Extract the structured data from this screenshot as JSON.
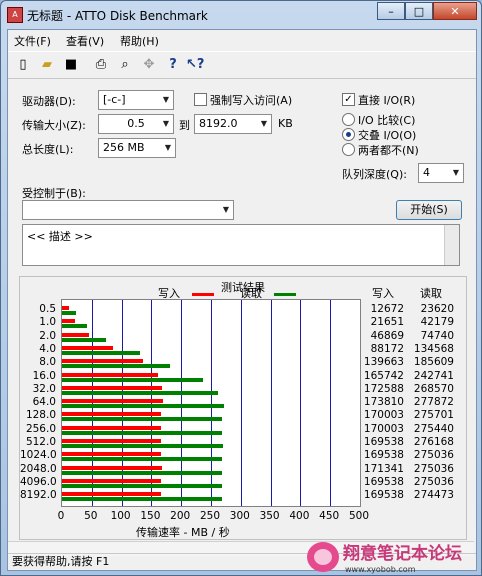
{
  "window": {
    "title": "无标题 - ATTO Disk Benchmark",
    "controls": {
      "minimize": "–",
      "maximize": "□",
      "close": "✕"
    }
  },
  "menu": [
    "文件(F)",
    "查看(V)",
    "帮助(H)"
  ],
  "toolbar": [
    "new-icon",
    "open-icon",
    "save-icon",
    "print-icon",
    "print-preview-icon",
    "move-icon",
    "help-icon",
    "context-help-icon"
  ],
  "form": {
    "drive_label": "驱动器(D):",
    "drive_value": "[-c-]",
    "force_write_label": "强制写入访问(A)",
    "transfer_label": "传输大小(Z):",
    "transfer_from": "0.5",
    "transfer_to_label": "到",
    "transfer_to": "8192.0",
    "transfer_unit": "KB",
    "total_label": "总长度(L):",
    "total_value": "256 MB",
    "direct_io_label": "直接 I/O(R)",
    "io_compare_label": "I/O 比较(C)",
    "overlap_io_label": "交叠 I/O(O)",
    "neither_label": "两者都不(N)",
    "queue_label": "队列深度(Q):",
    "queue_value": "4",
    "controlled_label": "受控制于(B):",
    "start_button": "开始(S)",
    "description": "<< 描述 >>"
  },
  "results": {
    "title": "测试结果",
    "legend_write": "写入",
    "legend_read": "读取",
    "col_write": "写入",
    "col_read": "读取",
    "xaxis_title": "传输速率 - MB / 秒"
  },
  "chart_data": {
    "type": "bar",
    "orientation": "horizontal",
    "categories": [
      "0.5",
      "1.0",
      "2.0",
      "4.0",
      "8.0",
      "16.0",
      "32.0",
      "64.0",
      "128.0",
      "256.0",
      "512.0",
      "1024.0",
      "2048.0",
      "4096.0",
      "8192.0"
    ],
    "series": [
      {
        "name": "写入",
        "color": "#ff0000",
        "values": [
          12672,
          21651,
          46869,
          88172,
          139663,
          165742,
          172588,
          173810,
          170003,
          170003,
          169538,
          169538,
          171341,
          169538,
          169538
        ]
      },
      {
        "name": "读取",
        "color": "#008000",
        "values": [
          23620,
          42179,
          74740,
          134568,
          185609,
          242741,
          268570,
          277872,
          275701,
          275440,
          276168,
          275036,
          275036,
          275036,
          274473
        ]
      }
    ],
    "x_ticks": [
      "0",
      "50",
      "100",
      "150",
      "200",
      "250",
      "300",
      "350",
      "400",
      "450",
      "500"
    ],
    "xlim": [
      0,
      500
    ],
    "grid": true
  },
  "status": {
    "text": "要获得帮助,请按 F1"
  },
  "watermark": {
    "text": "翔意笔记本论坛",
    "sub": "www.xyobob.com"
  }
}
